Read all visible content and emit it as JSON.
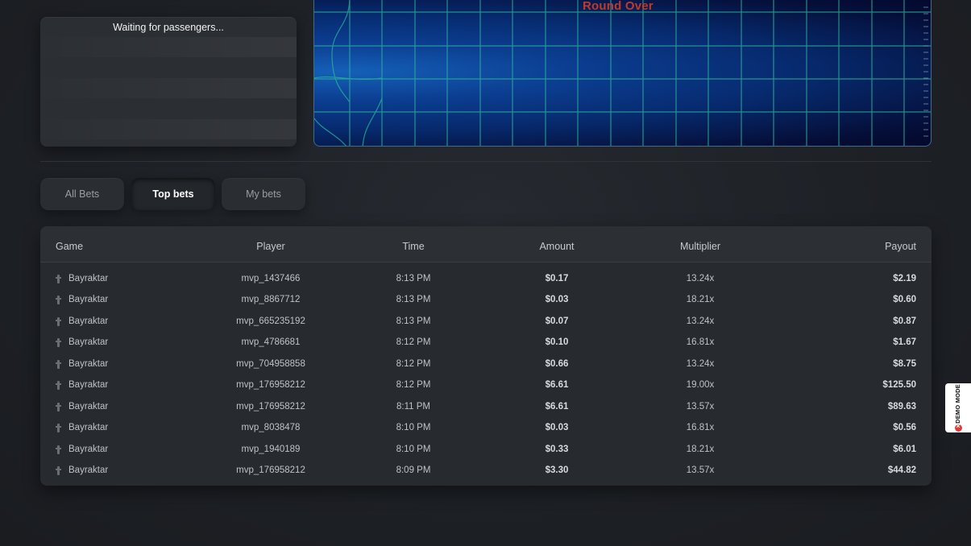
{
  "passengers": {
    "title": "Waiting for passengers..."
  },
  "game": {
    "status_text": "Round Over",
    "status_color": "#c0392b",
    "background_color": "#072a6e",
    "grid_color": "#2bb89a"
  },
  "tabs": [
    {
      "label": "All Bets",
      "active": false
    },
    {
      "label": "Top bets",
      "active": true
    },
    {
      "label": "My bets",
      "active": false
    }
  ],
  "table": {
    "columns": {
      "game": "Game",
      "player": "Player",
      "time": "Time",
      "amount": "Amount",
      "multiplier": "Multiplier",
      "payout": "Payout"
    },
    "rows": [
      {
        "game": "Bayraktar",
        "player": "mvp_1437466",
        "time": "8:13 PM",
        "amount": "$0.17",
        "multiplier": "13.24x",
        "payout": "$2.19"
      },
      {
        "game": "Bayraktar",
        "player": "mvp_8867712",
        "time": "8:13 PM",
        "amount": "$0.03",
        "multiplier": "18.21x",
        "payout": "$0.60"
      },
      {
        "game": "Bayraktar",
        "player": "mvp_665235192",
        "time": "8:13 PM",
        "amount": "$0.07",
        "multiplier": "13.24x",
        "payout": "$0.87"
      },
      {
        "game": "Bayraktar",
        "player": "mvp_4786681",
        "time": "8:12 PM",
        "amount": "$0.10",
        "multiplier": "16.81x",
        "payout": "$1.67"
      },
      {
        "game": "Bayraktar",
        "player": "mvp_704958858",
        "time": "8:12 PM",
        "amount": "$0.66",
        "multiplier": "13.24x",
        "payout": "$8.75"
      },
      {
        "game": "Bayraktar",
        "player": "mvp_176958212",
        "time": "8:12 PM",
        "amount": "$6.61",
        "multiplier": "19.00x",
        "payout": "$125.50"
      },
      {
        "game": "Bayraktar",
        "player": "mvp_176958212",
        "time": "8:11 PM",
        "amount": "$6.61",
        "multiplier": "13.57x",
        "payout": "$89.63"
      },
      {
        "game": "Bayraktar",
        "player": "mvp_8038478",
        "time": "8:10 PM",
        "amount": "$0.03",
        "multiplier": "16.81x",
        "payout": "$0.56"
      },
      {
        "game": "Bayraktar",
        "player": "mvp_1940189",
        "time": "8:10 PM",
        "amount": "$0.33",
        "multiplier": "18.21x",
        "payout": "$6.01"
      },
      {
        "game": "Bayraktar",
        "player": "mvp_176958212",
        "time": "8:09 PM",
        "amount": "$3.30",
        "multiplier": "13.57x",
        "payout": "$44.82"
      }
    ]
  },
  "demo_badge": {
    "label": "DEMO MODE"
  }
}
